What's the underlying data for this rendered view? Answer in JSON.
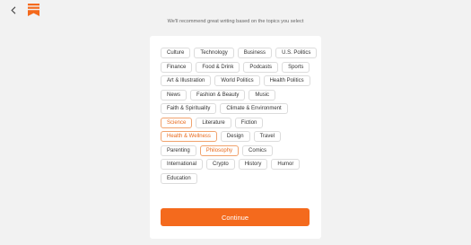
{
  "header": {
    "back_icon": "chevron-left-icon",
    "logo_icon": "substack-logo-icon",
    "accent_color": "#f46a1d"
  },
  "subtitle": "We'll recommend great writing based on the topics you select",
  "topics": [
    {
      "label": "Culture",
      "selected": false
    },
    {
      "label": "Technology",
      "selected": false
    },
    {
      "label": "Business",
      "selected": false
    },
    {
      "label": "U.S. Politics",
      "selected": false
    },
    {
      "label": "Finance",
      "selected": false
    },
    {
      "label": "Food & Drink",
      "selected": false
    },
    {
      "label": "Podcasts",
      "selected": false
    },
    {
      "label": "Sports",
      "selected": false
    },
    {
      "label": "Art & Illustration",
      "selected": false
    },
    {
      "label": "World Politics",
      "selected": false
    },
    {
      "label": "Health Politics",
      "selected": false
    },
    {
      "label": "News",
      "selected": false
    },
    {
      "label": "Fashion & Beauty",
      "selected": false
    },
    {
      "label": "Music",
      "selected": false
    },
    {
      "label": "Faith & Spirituality",
      "selected": false
    },
    {
      "label": "Climate & Environment",
      "selected": false
    },
    {
      "label": "Science",
      "selected": true
    },
    {
      "label": "Literature",
      "selected": false
    },
    {
      "label": "Fiction",
      "selected": false
    },
    {
      "label": "Health & Wellness",
      "selected": true
    },
    {
      "label": "Design",
      "selected": false
    },
    {
      "label": "Travel",
      "selected": false
    },
    {
      "label": "Parenting",
      "selected": false
    },
    {
      "label": "Philosophy",
      "selected": true
    },
    {
      "label": "Comics",
      "selected": false
    },
    {
      "label": "International",
      "selected": false
    },
    {
      "label": "Crypto",
      "selected": false
    },
    {
      "label": "History",
      "selected": false
    },
    {
      "label": "Humor",
      "selected": false
    },
    {
      "label": "Education",
      "selected": false
    }
  ],
  "continue_label": "Continue"
}
